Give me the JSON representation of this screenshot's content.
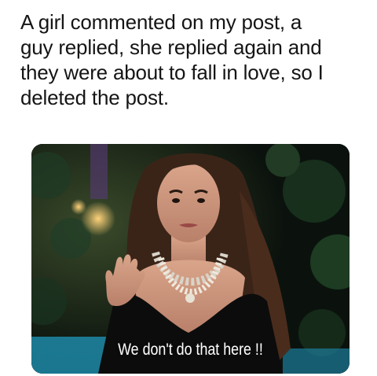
{
  "caption": {
    "lines": [
      "A girl commented on my post, a",
      "guy replied, she replied again and",
      "they were about to fall in love, so I",
      "deleted the post."
    ]
  },
  "meme": {
    "subtitle": "We don't do that here !!"
  }
}
